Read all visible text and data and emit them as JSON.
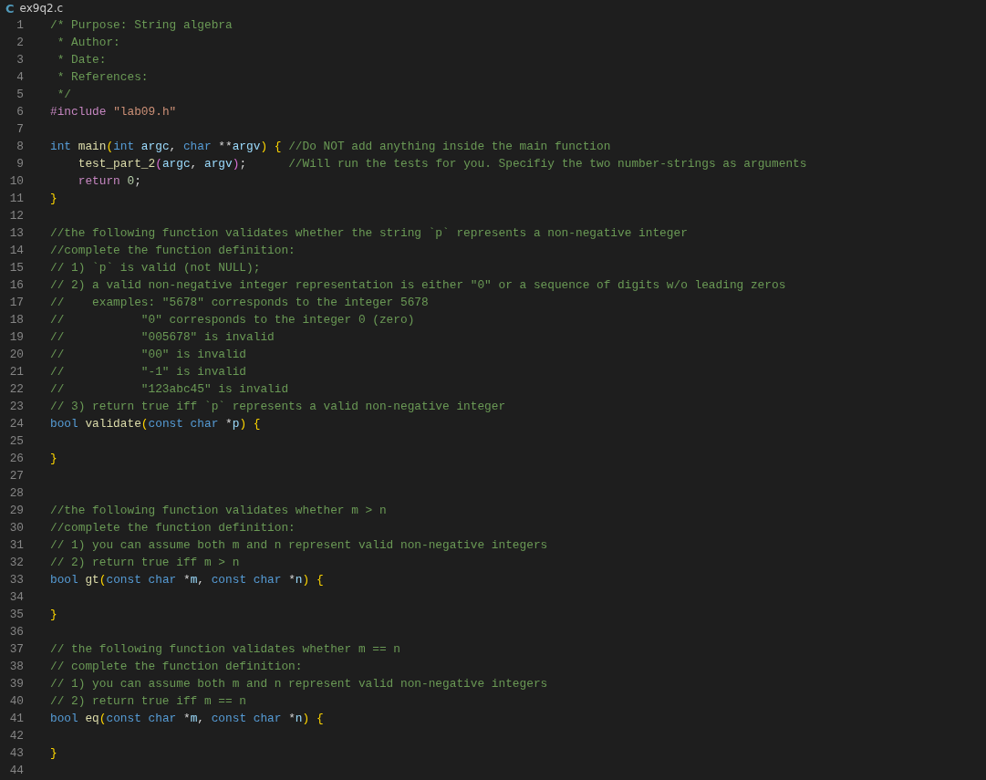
{
  "tab": {
    "icon_text": "C",
    "file_name": "ex9q2.c"
  },
  "lines": [
    {
      "number": "1",
      "tokens": [
        {
          "kind": "comment",
          "text": "/* Purpose: String algebra"
        }
      ]
    },
    {
      "number": "2",
      "tokens": [
        {
          "kind": "comment",
          "text": " * Author:"
        }
      ]
    },
    {
      "number": "3",
      "tokens": [
        {
          "kind": "comment",
          "text": " * Date:"
        }
      ]
    },
    {
      "number": "4",
      "tokens": [
        {
          "kind": "comment",
          "text": " * References:"
        }
      ]
    },
    {
      "number": "5",
      "tokens": [
        {
          "kind": "comment",
          "text": " */"
        }
      ]
    },
    {
      "number": "6",
      "tokens": [
        {
          "kind": "control",
          "text": "#include "
        },
        {
          "kind": "string",
          "text": "\"lab09.h\""
        }
      ]
    },
    {
      "number": "7"
    },
    {
      "number": "8",
      "tokens": [
        {
          "kind": "keyword",
          "text": "int "
        },
        {
          "kind": "function",
          "text": "main"
        },
        {
          "kind": "bracket1",
          "text": "("
        },
        {
          "kind": "keyword",
          "text": "int "
        },
        {
          "kind": "variable",
          "text": "argc"
        },
        {
          "kind": "plain",
          "text": ", "
        },
        {
          "kind": "keyword",
          "text": "char "
        },
        {
          "kind": "plain",
          "text": "**"
        },
        {
          "kind": "variable",
          "text": "argv"
        },
        {
          "kind": "bracket1",
          "text": ") { "
        },
        {
          "kind": "comment",
          "text": "//Do NOT add anything inside the main function"
        }
      ]
    },
    {
      "number": "9",
      "tokens": [
        {
          "kind": "function",
          "text": "    test_part_2"
        },
        {
          "kind": "bracket2",
          "text": "("
        },
        {
          "kind": "variable",
          "text": "argc"
        },
        {
          "kind": "plain",
          "text": ", "
        },
        {
          "kind": "variable",
          "text": "argv"
        },
        {
          "kind": "bracket2",
          "text": ")"
        },
        {
          "kind": "plain",
          "text": ";      "
        },
        {
          "kind": "comment",
          "text": "//Will run the tests for you. Specifiy the two number-strings as arguments"
        }
      ]
    },
    {
      "number": "10",
      "tokens": [
        {
          "kind": "control",
          "text": "    return "
        },
        {
          "kind": "number",
          "text": "0"
        },
        {
          "kind": "plain",
          "text": ";"
        }
      ]
    },
    {
      "number": "11",
      "tokens": [
        {
          "kind": "bracket1",
          "text": "}"
        }
      ]
    },
    {
      "number": "12"
    },
    {
      "number": "13",
      "tokens": [
        {
          "kind": "comment",
          "text": "//the following function validates whether the string `p` represents a non-negative integer"
        }
      ]
    },
    {
      "number": "14",
      "tokens": [
        {
          "kind": "comment",
          "text": "//complete the function definition:"
        }
      ]
    },
    {
      "number": "15",
      "tokens": [
        {
          "kind": "comment",
          "text": "// 1) `p` is valid (not NULL);"
        }
      ]
    },
    {
      "number": "16",
      "tokens": [
        {
          "kind": "comment",
          "text": "// 2) a valid non-negative integer representation is either \"0\" or a sequence of digits w/o leading zeros"
        }
      ]
    },
    {
      "number": "17",
      "tokens": [
        {
          "kind": "comment",
          "text": "//    examples: \"5678\" corresponds to the integer 5678"
        }
      ]
    },
    {
      "number": "18",
      "tokens": [
        {
          "kind": "comment",
          "text": "//           \"0\" corresponds to the integer 0 (zero)"
        }
      ]
    },
    {
      "number": "19",
      "tokens": [
        {
          "kind": "comment",
          "text": "//           \"005678\" is invalid"
        }
      ]
    },
    {
      "number": "20",
      "tokens": [
        {
          "kind": "comment",
          "text": "//           \"00\" is invalid"
        }
      ]
    },
    {
      "number": "21",
      "tokens": [
        {
          "kind": "comment",
          "text": "//           \"-1\" is invalid"
        }
      ]
    },
    {
      "number": "22",
      "tokens": [
        {
          "kind": "comment",
          "text": "//           \"123abc45\" is invalid"
        }
      ]
    },
    {
      "number": "23",
      "tokens": [
        {
          "kind": "comment",
          "text": "// 3) return true iff `p` represents a valid non-negative integer"
        }
      ]
    },
    {
      "number": "24",
      "tokens": [
        {
          "kind": "keyword",
          "text": "bool "
        },
        {
          "kind": "function",
          "text": "validate"
        },
        {
          "kind": "bracket1",
          "text": "("
        },
        {
          "kind": "keyword",
          "text": "const char "
        },
        {
          "kind": "plain",
          "text": "*"
        },
        {
          "kind": "variable",
          "text": "p"
        },
        {
          "kind": "bracket1",
          "text": ") {"
        }
      ]
    },
    {
      "number": "25"
    },
    {
      "number": "26",
      "tokens": [
        {
          "kind": "bracket1",
          "text": "}"
        }
      ]
    },
    {
      "number": "27"
    },
    {
      "number": "28"
    },
    {
      "number": "29",
      "tokens": [
        {
          "kind": "comment",
          "text": "//the following function validates whether m > n"
        }
      ]
    },
    {
      "number": "30",
      "tokens": [
        {
          "kind": "comment",
          "text": "//complete the function definition:"
        }
      ]
    },
    {
      "number": "31",
      "tokens": [
        {
          "kind": "comment",
          "text": "// 1) you can assume both m and n represent valid non-negative integers"
        }
      ]
    },
    {
      "number": "32",
      "tokens": [
        {
          "kind": "comment",
          "text": "// 2) return true iff m > n"
        }
      ]
    },
    {
      "number": "33",
      "tokens": [
        {
          "kind": "keyword",
          "text": "bool "
        },
        {
          "kind": "function",
          "text": "gt"
        },
        {
          "kind": "bracket1",
          "text": "("
        },
        {
          "kind": "keyword",
          "text": "const char "
        },
        {
          "kind": "plain",
          "text": "*"
        },
        {
          "kind": "variable",
          "text": "m"
        },
        {
          "kind": "plain",
          "text": ", "
        },
        {
          "kind": "keyword",
          "text": "const char "
        },
        {
          "kind": "plain",
          "text": "*"
        },
        {
          "kind": "variable",
          "text": "n"
        },
        {
          "kind": "bracket1",
          "text": ") {"
        }
      ]
    },
    {
      "number": "34"
    },
    {
      "number": "35",
      "tokens": [
        {
          "kind": "bracket1",
          "text": "}"
        }
      ]
    },
    {
      "number": "36"
    },
    {
      "number": "37",
      "tokens": [
        {
          "kind": "comment",
          "text": "// the following function validates whether m == n"
        }
      ]
    },
    {
      "number": "38",
      "tokens": [
        {
          "kind": "comment",
          "text": "// complete the function definition:"
        }
      ]
    },
    {
      "number": "39",
      "tokens": [
        {
          "kind": "comment",
          "text": "// 1) you can assume both m and n represent valid non-negative integers"
        }
      ]
    },
    {
      "number": "40",
      "tokens": [
        {
          "kind": "comment",
          "text": "// 2) return true iff m == n"
        }
      ]
    },
    {
      "number": "41",
      "tokens": [
        {
          "kind": "keyword",
          "text": "bool "
        },
        {
          "kind": "function",
          "text": "eq"
        },
        {
          "kind": "bracket1",
          "text": "("
        },
        {
          "kind": "keyword",
          "text": "const char "
        },
        {
          "kind": "plain",
          "text": "*"
        },
        {
          "kind": "variable",
          "text": "m"
        },
        {
          "kind": "plain",
          "text": ", "
        },
        {
          "kind": "keyword",
          "text": "const char "
        },
        {
          "kind": "plain",
          "text": "*"
        },
        {
          "kind": "variable",
          "text": "n"
        },
        {
          "kind": "bracket1",
          "text": ") {"
        }
      ]
    },
    {
      "number": "42"
    },
    {
      "number": "43",
      "tokens": [
        {
          "kind": "bracket1",
          "text": "}"
        }
      ]
    },
    {
      "number": "44"
    }
  ]
}
